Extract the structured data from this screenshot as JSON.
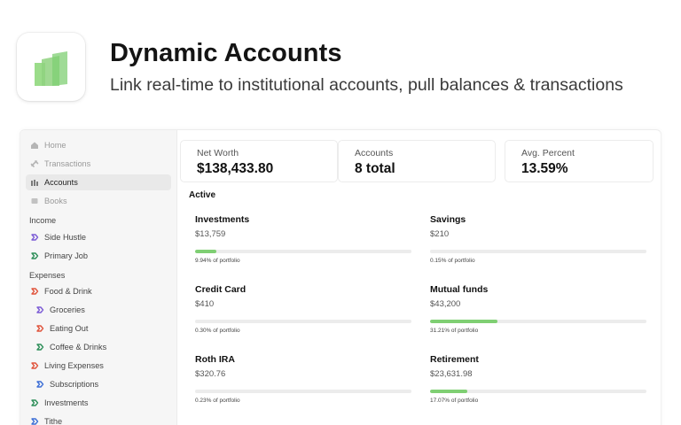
{
  "hero": {
    "title": "Dynamic Accounts",
    "subtitle": "Link real-time to institutional accounts, pull balances & transactions",
    "logo_icon": "bar-chart-logo-icon",
    "logo_color": "#8fd27f"
  },
  "sidebar": {
    "top_items": [
      {
        "label": "Home",
        "icon": "home-icon",
        "active": false
      },
      {
        "label": "Transactions",
        "icon": "link-icon",
        "active": false
      },
      {
        "label": "Accounts",
        "icon": "bank-icon",
        "active": true
      },
      {
        "label": "Books",
        "icon": "book-icon",
        "active": false
      }
    ],
    "income_label": "Income",
    "income_items": [
      {
        "label": "Side Hustle",
        "icon": "category-chevron-icon",
        "color": "#7c5cd6"
      },
      {
        "label": "Primary Job",
        "icon": "category-chevron-icon",
        "color": "#2f8f5a"
      }
    ],
    "expenses_label": "Expenses",
    "expense_items": [
      {
        "label": "Food & Drink",
        "icon": "category-chevron-icon",
        "color": "#e0553d",
        "indent": 0
      },
      {
        "label": "Groceries",
        "icon": "category-chevron-icon",
        "color": "#7c5cd6",
        "indent": 1
      },
      {
        "label": "Eating Out",
        "icon": "category-chevron-icon",
        "color": "#e0553d",
        "indent": 1
      },
      {
        "label": "Coffee & Drinks",
        "icon": "category-chevron-icon",
        "color": "#2f8f5a",
        "indent": 1
      },
      {
        "label": "Living Expenses",
        "icon": "category-chevron-icon",
        "color": "#e0553d",
        "indent": 0
      },
      {
        "label": "Subscriptions",
        "icon": "category-chevron-icon",
        "color": "#3d6fd6",
        "indent": 1
      },
      {
        "label": "Investments",
        "icon": "category-chevron-icon",
        "color": "#2f8f5a",
        "indent": 0
      },
      {
        "label": "Tithe",
        "icon": "category-chevron-icon",
        "color": "#3d6fd6",
        "indent": 0
      }
    ]
  },
  "stats": [
    {
      "label": "Net Worth",
      "value": "$138,433.80"
    },
    {
      "label": "Accounts",
      "value": "8 total"
    },
    {
      "label": "Avg. Percent",
      "value": "13.59%"
    }
  ],
  "active_heading": "Active",
  "accounts": [
    {
      "name": "Investments",
      "balance": "$13,759",
      "portfolio_pct": 9.94,
      "note": "9.94% of portfolio"
    },
    {
      "name": "Savings",
      "balance": "$210",
      "portfolio_pct": 0.15,
      "note": "0.15% of portfolio"
    },
    {
      "name": "Credit Card",
      "balance": "$410",
      "portfolio_pct": 0.3,
      "note": "0.30% of portfolio"
    },
    {
      "name": "Mutual funds",
      "balance": "$43,200",
      "portfolio_pct": 31.21,
      "note": "31.21% of portfolio"
    },
    {
      "name": "Roth IRA",
      "balance": "$320.76",
      "portfolio_pct": 0.23,
      "note": "0.23% of portfolio"
    },
    {
      "name": "Retirement",
      "balance": "$23,631.98",
      "portfolio_pct": 17.07,
      "note": "17.07% of portfolio"
    }
  ],
  "colors": {
    "progress_fill": "#7fcf73",
    "progress_track": "#ececec"
  }
}
